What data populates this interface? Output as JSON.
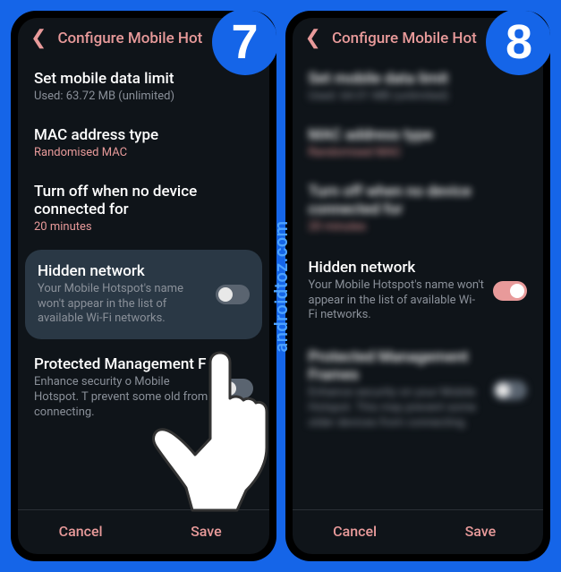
{
  "watermark": "androidtoz.com",
  "steps": {
    "seven": "7",
    "eight": "8"
  },
  "header": {
    "title": "Configure Mobile Hot"
  },
  "items": {
    "data_limit": {
      "title": "Set mobile data limit",
      "sub": "Used: 63.72 MB (unlimited)",
      "sub_alt": "Used: 64.01 MB (unlimited)"
    },
    "mac": {
      "title": "MAC address type",
      "sub": "Randomised MAC"
    },
    "timeout": {
      "title": "Turn off when no device connected for",
      "sub": "20 minutes"
    },
    "hidden": {
      "title": "Hidden network",
      "sub": "Your Mobile Hotspot's name won't appear in the list of available Wi-Fi networks."
    },
    "pmf": {
      "title": "Protected Management F",
      "title_full": "Protected Management Frames",
      "sub": "Enhance security o     Mobile Hotspot. T    prevent some old     from connecting.",
      "sub_full": "Enhance security on your Mobile Hotspot. This may prevent some older devices from connecting."
    }
  },
  "footer": {
    "cancel": "Cancel",
    "save": "Save"
  }
}
